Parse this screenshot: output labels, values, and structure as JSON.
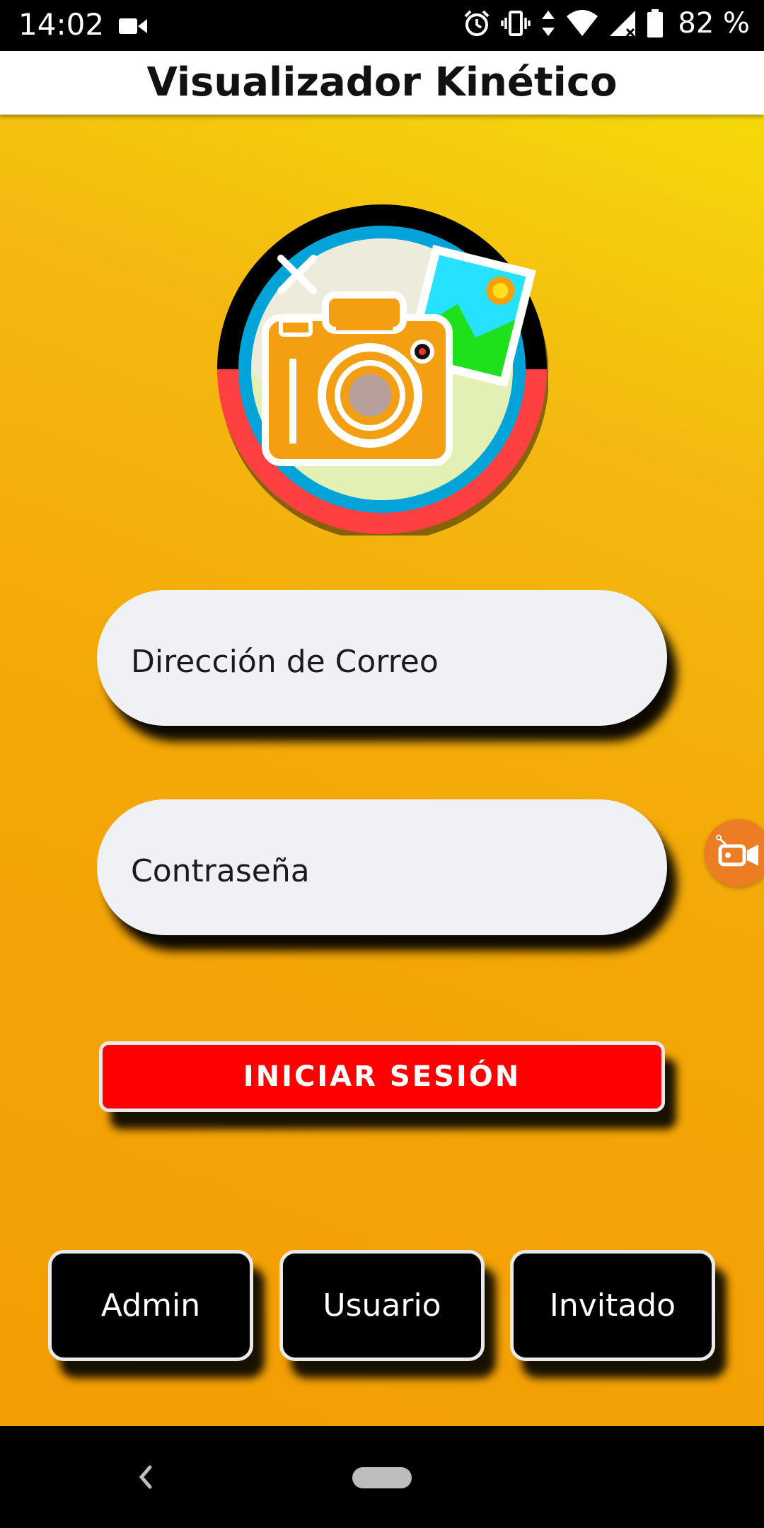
{
  "status_bar": {
    "time": "14:02",
    "battery_percent": "82 %",
    "icons": [
      "video-camera-icon",
      "alarm-icon",
      "vibrate-icon",
      "data-arrows-icon",
      "wifi-icon",
      "signal-icon",
      "battery-icon"
    ]
  },
  "app_bar": {
    "title": "Visualizador Kinético"
  },
  "login_form": {
    "email_placeholder": "Dirección de Correo",
    "password_placeholder": "Contraseña",
    "login_button": "INICIAR SESIÓN"
  },
  "role_buttons": [
    "Admin",
    "Usuario",
    "Invitado"
  ],
  "floating_button": {
    "icon": "screen-recorder-icon"
  },
  "nav_bar": {
    "icons": [
      "back-icon",
      "home-pill-icon"
    ]
  },
  "colors": {
    "gradient_top": "#f6d90a",
    "gradient_bottom": "#f39d04",
    "login_button": "#ff0000",
    "role_button": "#000000",
    "field_background": "#f0f1f5",
    "floating_button": "#ec7d22"
  }
}
